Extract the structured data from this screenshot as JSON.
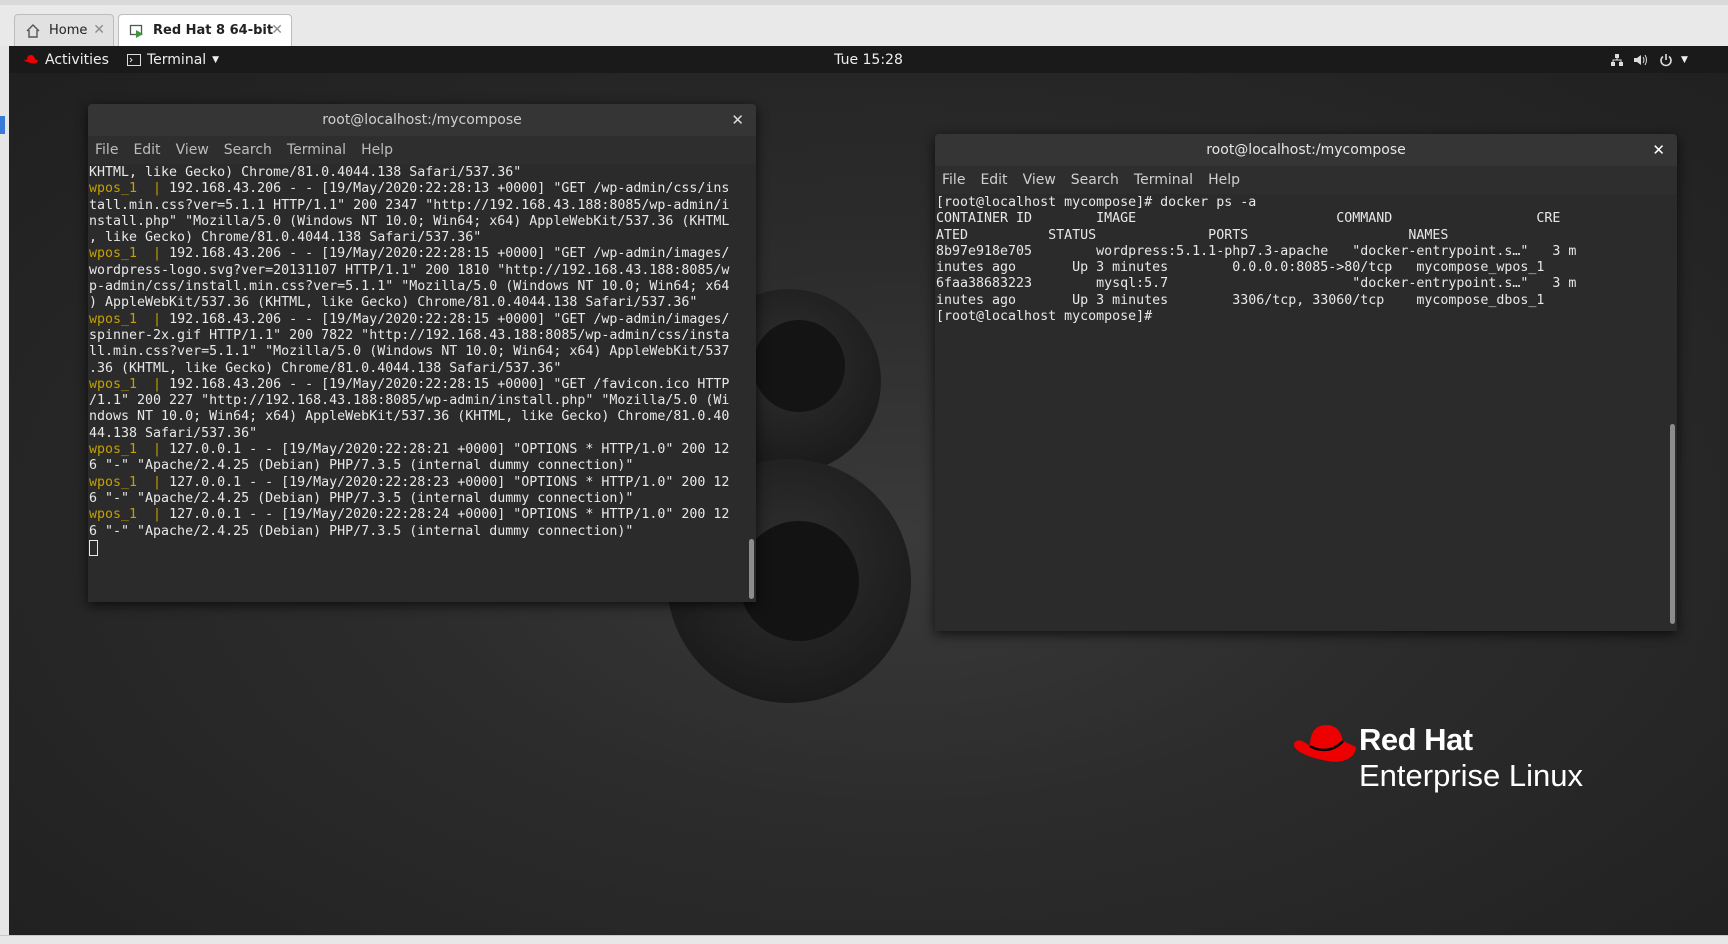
{
  "vm": {
    "tabs": [
      {
        "label": "Home",
        "icon": "home-icon"
      },
      {
        "label": "Red Hat  8 64-bit",
        "icon": "vm-icon"
      }
    ]
  },
  "gnome": {
    "activities": "Activities",
    "app_menu": "Terminal",
    "clock": "Tue 15:28"
  },
  "term_left": {
    "title": "root@localhost:/mycompose",
    "menu": [
      "File",
      "Edit",
      "View",
      "Search",
      "Terminal",
      "Help"
    ],
    "lines": [
      {
        "p": "",
        "t": "KHTML, like Gecko) Chrome/81.0.4044.138 Safari/537.36\""
      },
      {
        "p": "wpos_1  | ",
        "t": "192.168.43.206 - - [19/May/2020:22:28:13 +0000] \"GET /wp-admin/css/ins"
      },
      {
        "p": "",
        "t": "tall.min.css?ver=5.1.1 HTTP/1.1\" 200 2347 \"http://192.168.43.188:8085/wp-admin/i"
      },
      {
        "p": "",
        "t": "nstall.php\" \"Mozilla/5.0 (Windows NT 10.0; Win64; x64) AppleWebKit/537.36 (KHTML"
      },
      {
        "p": "",
        "t": ", like Gecko) Chrome/81.0.4044.138 Safari/537.36\""
      },
      {
        "p": "wpos_1  | ",
        "t": "192.168.43.206 - - [19/May/2020:22:28:15 +0000] \"GET /wp-admin/images/"
      },
      {
        "p": "",
        "t": "wordpress-logo.svg?ver=20131107 HTTP/1.1\" 200 1810 \"http://192.168.43.188:8085/w"
      },
      {
        "p": "",
        "t": "p-admin/css/install.min.css?ver=5.1.1\" \"Mozilla/5.0 (Windows NT 10.0; Win64; x64"
      },
      {
        "p": "",
        "t": ") AppleWebKit/537.36 (KHTML, like Gecko) Chrome/81.0.4044.138 Safari/537.36\""
      },
      {
        "p": "wpos_1  | ",
        "t": "192.168.43.206 - - [19/May/2020:22:28:15 +0000] \"GET /wp-admin/images/"
      },
      {
        "p": "",
        "t": "spinner-2x.gif HTTP/1.1\" 200 7822 \"http://192.168.43.188:8085/wp-admin/css/insta"
      },
      {
        "p": "",
        "t": "ll.min.css?ver=5.1.1\" \"Mozilla/5.0 (Windows NT 10.0; Win64; x64) AppleWebKit/537"
      },
      {
        "p": "",
        "t": ".36 (KHTML, like Gecko) Chrome/81.0.4044.138 Safari/537.36\""
      },
      {
        "p": "wpos_1  | ",
        "t": "192.168.43.206 - - [19/May/2020:22:28:15 +0000] \"GET /favicon.ico HTTP"
      },
      {
        "p": "",
        "t": "/1.1\" 200 227 \"http://192.168.43.188:8085/wp-admin/install.php\" \"Mozilla/5.0 (Wi"
      },
      {
        "p": "",
        "t": "ndows NT 10.0; Win64; x64) AppleWebKit/537.36 (KHTML, like Gecko) Chrome/81.0.40"
      },
      {
        "p": "",
        "t": "44.138 Safari/537.36\""
      },
      {
        "p": "wpos_1  | ",
        "t": "127.0.0.1 - - [19/May/2020:22:28:21 +0000] \"OPTIONS * HTTP/1.0\" 200 12"
      },
      {
        "p": "",
        "t": "6 \"-\" \"Apache/2.4.25 (Debian) PHP/7.3.5 (internal dummy connection)\""
      },
      {
        "p": "wpos_1  | ",
        "t": "127.0.0.1 - - [19/May/2020:22:28:23 +0000] \"OPTIONS * HTTP/1.0\" 200 12"
      },
      {
        "p": "",
        "t": "6 \"-\" \"Apache/2.4.25 (Debian) PHP/7.3.5 (internal dummy connection)\""
      },
      {
        "p": "wpos_1  | ",
        "t": "127.0.0.1 - - [19/May/2020:22:28:24 +0000] \"OPTIONS * HTTP/1.0\" 200 12"
      },
      {
        "p": "",
        "t": "6 \"-\" \"Apache/2.4.25 (Debian) PHP/7.3.5 (internal dummy connection)\""
      }
    ]
  },
  "term_right": {
    "title": "root@localhost:/mycompose",
    "menu": [
      "File",
      "Edit",
      "View",
      "Search",
      "Terminal",
      "Help"
    ],
    "lines": [
      "[root@localhost mycompose]# docker ps -a",
      "CONTAINER ID        IMAGE                         COMMAND                  CRE",
      "ATED          STATUS              PORTS                    NAMES",
      "8b97e918e705        wordpress:5.1.1-php7.3-apache   \"docker-entrypoint.s…\"   3 m",
      "inutes ago       Up 3 minutes        0.0.0.0:8085->80/tcp   mycompose_wpos_1",
      "6faa38683223        mysql:5.7                       \"docker-entrypoint.s…\"   3 m",
      "inutes ago       Up 3 minutes        3306/tcp, 33060/tcp    mycompose_dbos_1",
      "[root@localhost mycompose]#"
    ]
  },
  "branding": {
    "line1": "Red Hat",
    "line2": "Enterprise Linux",
    "big_glyph": "8"
  },
  "colors": {
    "brand_red": "#ee0000",
    "log_prefix": "#c4a000"
  }
}
